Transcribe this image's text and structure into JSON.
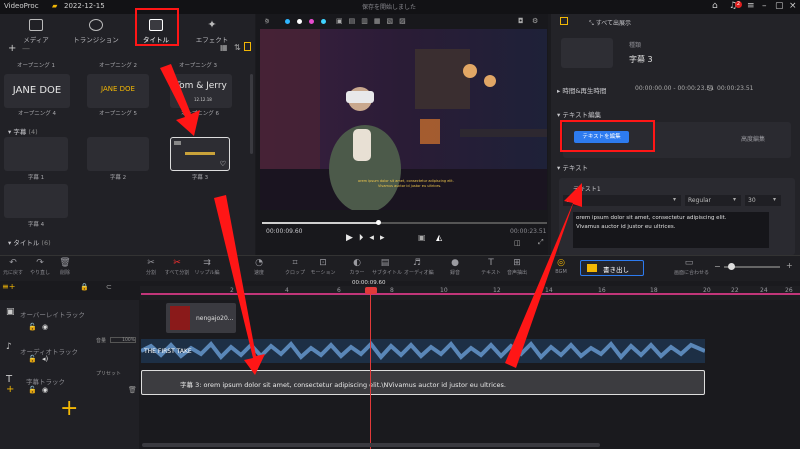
{
  "titlebar": {
    "app_name": "VideoProc",
    "date": "2022-12-15",
    "status": "保存を開始しました",
    "notification_count": "2"
  },
  "tabs": [
    {
      "label": "メディア"
    },
    {
      "label": "トランジション"
    },
    {
      "label": "タイトル"
    },
    {
      "label": "エフェクト"
    }
  ],
  "media": {
    "row1_captions": [
      "オープニング 1",
      "オープニング 2",
      "オープニング 3"
    ],
    "row2": [
      {
        "thumb_text": "JANE DOE",
        "caption": "オープニング 4"
      },
      {
        "thumb_text": "JANE DOE",
        "caption": "オープニング 5"
      },
      {
        "thumb_text": "Tom & Jerry",
        "sub": "12.12.18",
        "caption": "オープニング 6"
      }
    ],
    "subtitle_section": "字幕",
    "subtitle_count": "(4)",
    "subtitles": [
      "字幕 1",
      "字幕 2",
      "字幕 3",
      "字幕 4"
    ],
    "title_section": "タイトル",
    "title_count": "(6)"
  },
  "preview": {
    "current_time": "00:00:09.60",
    "total_time": "00:00:23.51"
  },
  "inspector": {
    "show_all": "すべて出展示",
    "kind_label": "種類",
    "kind_value": "字幕 3",
    "time_section": "時間&再生時間",
    "time_range": "00:00:00.00 - 00:00:23.51",
    "duration": "00:00:23.51",
    "text_edit_section": "テキスト編集",
    "edit_text_button": "テキストを編集",
    "advanced_edit": "高度編集",
    "text_section": "テキスト",
    "text_item": "テキスト1",
    "font_weight": "Regular",
    "font_size": "30",
    "body_text_1": "orem ipsum dolor sit amet, consectetur adipiscing elit.",
    "body_text_2": "Vivamus auctor id justor eu ultrices."
  },
  "toolbar": {
    "undo": "元に戻す",
    "redo": "やり直し",
    "delete": "削除",
    "split": "分割",
    "split_all": "すべて分割",
    "ripple": "リップル編",
    "speed": "速度",
    "crop": "クロップ",
    "motion": "モーション",
    "color": "カラー",
    "subtitle": "サブタイトル",
    "audio_edit": "オーディオ編",
    "record": "録音",
    "text": "テキスト",
    "voice": "音声抽出",
    "bgm": "BGM",
    "export": "書き出し",
    "fit": "画面に合わせる"
  },
  "timeline": {
    "playhead": "00:00:09.60",
    "ticks": [
      "2",
      "4",
      "6",
      "8",
      "10",
      "12",
      "14",
      "16",
      "18",
      "20",
      "22",
      "24",
      "26"
    ],
    "overlay_track": "オーバーレイトラック",
    "overlay_clip": "nengajo20...",
    "audio_track": "オーディオトラック",
    "volume_label": "音量",
    "volume_value": "100%",
    "audio_clip": "THE FIRST TAKE",
    "subtitle_track": "字幕トラック",
    "subtitle_style": "プリセット",
    "subtitle_clip": "字幕 3: orem ipsum dolor sit amet, consectetur adipiscing elit.\\NVivamus auctor id justor eu ultrices."
  },
  "colors": {
    "accent": "#2d7bf0",
    "highlight": "#ff1616",
    "playhead": "#e13a3a"
  }
}
